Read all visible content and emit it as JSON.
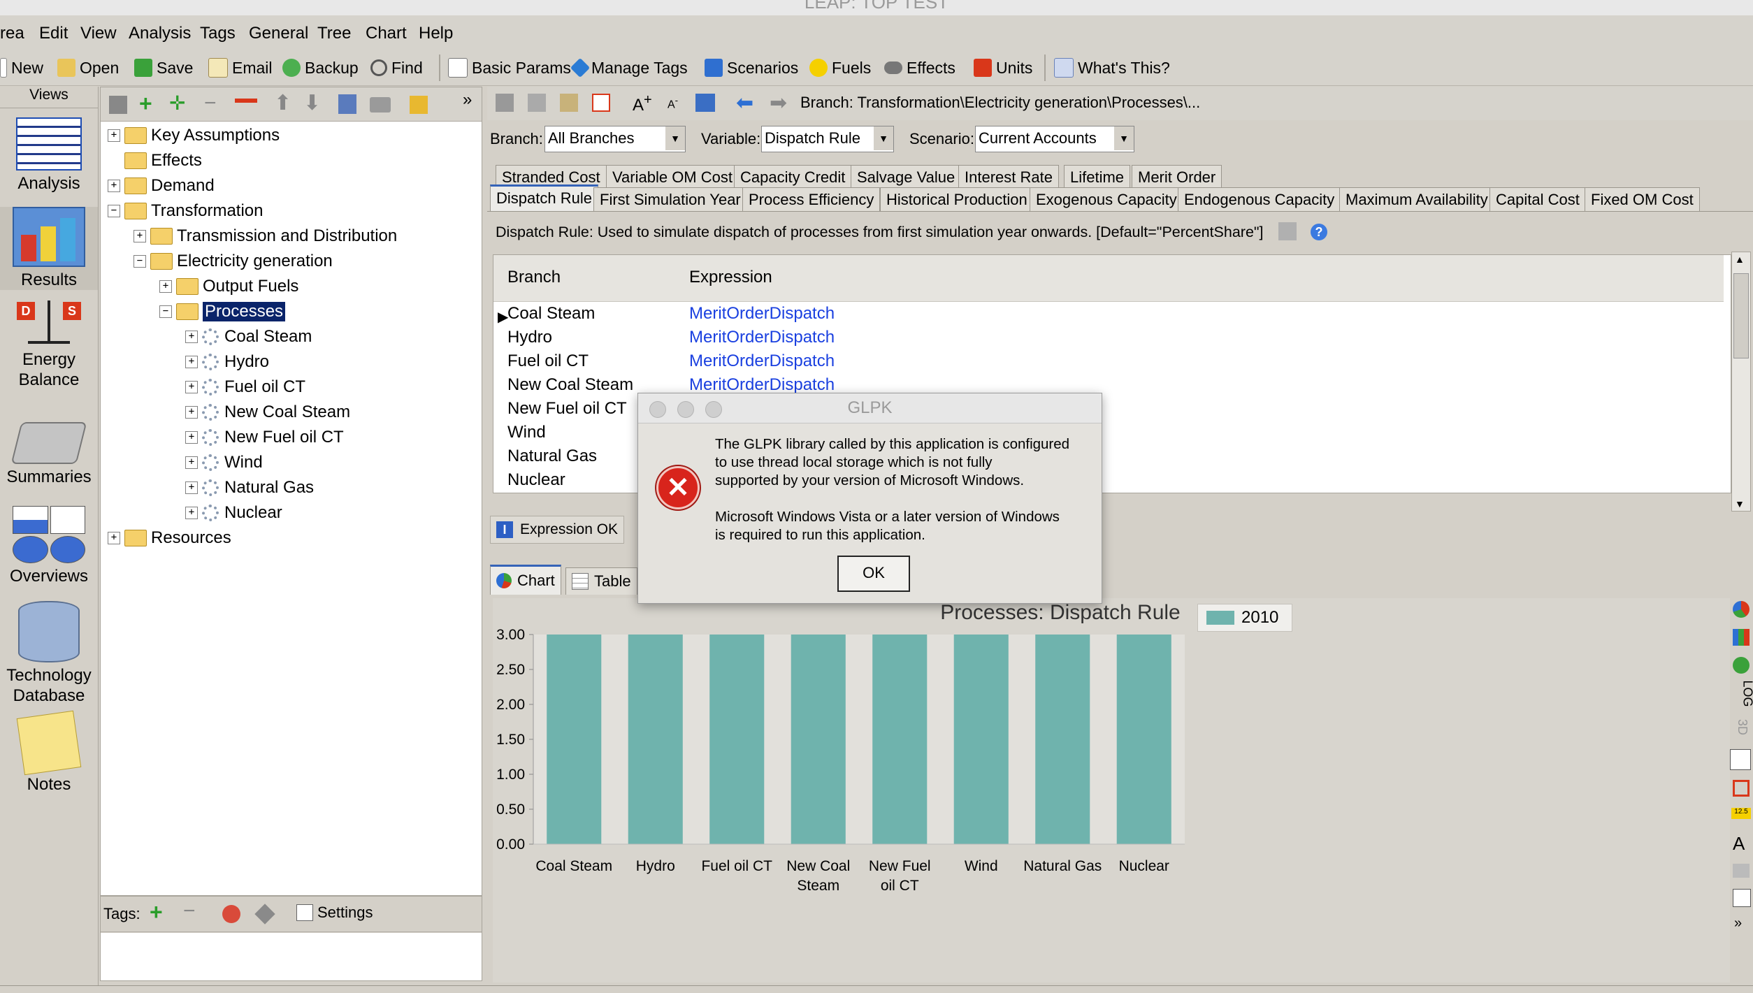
{
  "window": {
    "title": "LEAP: TOP TEST"
  },
  "menu": [
    "rea",
    "Edit",
    "View",
    "Analysis",
    "Tags",
    "General",
    "Tree",
    "Chart",
    "Help"
  ],
  "toolbar": {
    "new": "New",
    "open": "Open",
    "save": "Save",
    "email": "Email",
    "backup": "Backup",
    "find": "Find",
    "basic_params": "Basic Params",
    "manage_tags": "Manage Tags",
    "scenarios": "Scenarios",
    "fuels": "Fuels",
    "effects": "Effects",
    "units": "Units",
    "whats_this": "What's This?"
  },
  "views": {
    "header": "Views",
    "items": [
      "Analysis",
      "Results",
      "Energy Balance",
      "Summaries",
      "Overviews",
      "Technology Database",
      "Notes"
    ]
  },
  "tree": {
    "nodes": [
      "Key Assumptions",
      "Effects",
      "Demand",
      "Transformation",
      "Transmission and Distribution",
      "Electricity generation",
      "Output Fuels",
      "Processes",
      "Coal Steam",
      "Hydro",
      "Fuel oil CT",
      "New Coal Steam",
      "New Fuel oil CT",
      "Wind",
      "Natural Gas",
      "Nuclear",
      "Resources"
    ],
    "tags_label": "Tags:",
    "settings_label": "Settings"
  },
  "main": {
    "breadcrumb": "Branch: Transformation\\Electricity generation\\Processes\\...",
    "branch_label": "Branch:",
    "branch_value": "All Branches",
    "variable_label": "Variable:",
    "variable_value": "Dispatch Rule",
    "scenario_label": "Scenario:",
    "scenario_value": "Current Accounts",
    "tabs_row1": [
      "Stranded Cost",
      "Variable OM Cost",
      "Capacity Credit",
      "Salvage Value",
      "Interest Rate",
      "Lifetime",
      "Merit Order"
    ],
    "tabs_row2": [
      "Dispatch Rule",
      "First Simulation Year",
      "Process Efficiency",
      "Historical Production",
      "Exogenous Capacity",
      "Endogenous Capacity",
      "Maximum Availability",
      "Capital Cost",
      "Fixed OM Cost"
    ],
    "description": "Dispatch Rule: Used to simulate dispatch of processes from first simulation year onwards. [Default=\"PercentShare\"]",
    "grid_headers": [
      "Branch",
      "Expression"
    ],
    "grid_rows": [
      {
        "branch": "Coal Steam",
        "expr": "MeritOrderDispatch"
      },
      {
        "branch": "Hydro",
        "expr": "MeritOrderDispatch"
      },
      {
        "branch": "Fuel oil CT",
        "expr": "MeritOrderDispatch"
      },
      {
        "branch": "New Coal Steam",
        "expr": "MeritOrderDispatch"
      },
      {
        "branch": "New Fuel oil CT",
        "expr": ""
      },
      {
        "branch": "Wind",
        "expr": ""
      },
      {
        "branch": "Natural Gas",
        "expr": ""
      },
      {
        "branch": "Nuclear",
        "expr": ""
      }
    ],
    "expression_status": "Expression OK",
    "chart_tab": "Chart",
    "table_tab": "Table"
  },
  "chart_data": {
    "type": "bar",
    "title": "Processes: Dispatch Rule",
    "categories": [
      "Coal Steam",
      "Hydro",
      "Fuel oil CT",
      "New Coal Steam",
      "New Fuel oil CT",
      "Wind",
      "Natural Gas",
      "Nuclear"
    ],
    "category_lines": [
      [
        "Coal Steam"
      ],
      [
        "Hydro"
      ],
      [
        "Fuel oil CT"
      ],
      [
        "New Coal",
        "Steam"
      ],
      [
        "New Fuel",
        "oil CT"
      ],
      [
        "Wind"
      ],
      [
        "Natural Gas"
      ],
      [
        "Nuclear"
      ]
    ],
    "series": [
      {
        "name": "2010",
        "values": [
          3,
          3,
          3,
          3,
          3,
          3,
          3,
          3
        ]
      }
    ],
    "yticks": [
      "3.00",
      "2.50",
      "2.00",
      "1.50",
      "1.00",
      "0.50",
      "0.00"
    ],
    "ylim": [
      0,
      3
    ],
    "bar_color": "#6fb3ad",
    "legend": "top-right"
  },
  "dialog": {
    "title": "GLPK",
    "message1": "The GLPK library called by this application is configured\nto use thread local storage which is not fully\nsupported by your version of Microsoft Windows.",
    "message2": "Microsoft Windows Vista or a later version of Windows\nis required to run this application.",
    "ok": "OK"
  }
}
